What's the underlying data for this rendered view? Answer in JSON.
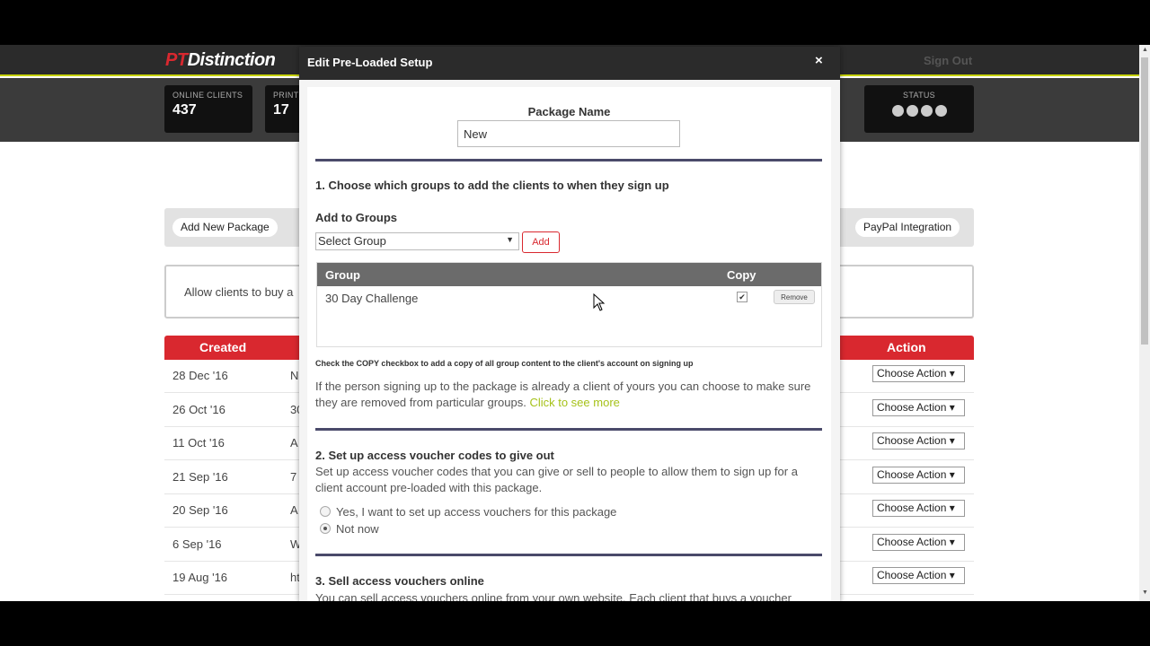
{
  "app": {
    "logo_pt": "PT",
    "logo_rest": "Distinction",
    "sign_out": "Sign Out"
  },
  "stats": {
    "online_label": "ONLINE CLIENTS",
    "online_value": "437",
    "print_label": "PRINT",
    "print_value": "17",
    "status_label": "STATUS"
  },
  "actions": {
    "add_new_package": "Add New Package",
    "paypal_integration": "PayPal Integration"
  },
  "info": {
    "text": "Allow clients to buy a"
  },
  "table": {
    "created_header": "Created",
    "action_header": "Action",
    "rows": [
      {
        "date": "28 Dec '16",
        "name": "N",
        "action": "Choose Action ▾"
      },
      {
        "date": "26 Oct '16",
        "name": "30",
        "action": "Choose Action ▾"
      },
      {
        "date": "11 Oct '16",
        "name": "A",
        "action": "Choose Action ▾"
      },
      {
        "date": "21 Sep '16",
        "name": "7",
        "action": "Choose Action ▾"
      },
      {
        "date": "20 Sep '16",
        "name": "A",
        "action": "Choose Action ▾"
      },
      {
        "date": "6 Sep '16",
        "name": "W",
        "action": "Choose Action ▾"
      },
      {
        "date": "19 Aug '16",
        "name": "ht",
        "action": "Choose Action ▾"
      }
    ]
  },
  "modal": {
    "title": "Edit Pre-Loaded Setup",
    "close": "×",
    "package_name_label": "Package Name",
    "package_name_value": "New",
    "section1_title": "1. Choose which groups to add the clients to when they sign up",
    "add_to_groups_label": "Add to Groups",
    "select_group": "Select Group",
    "add_button": "Add",
    "group_header": "Group",
    "copy_header": "Copy",
    "group_row": "30 Day Challenge",
    "remove_button": "Remove",
    "copy_note": "Check the COPY checkbox to add a copy of all group content to the client's account on signing up",
    "existing_client_text": "If the person signing up to the package is already a client of yours you can choose to make sure they are removed from particular groups.",
    "click_to_see_more": "Click to see more",
    "section2_title": "2. Set up access voucher codes to give out",
    "section2_text": "Set up access voucher codes that you can give or sell to people to allow them to sign up for a client account pre-loaded with this package.",
    "radio_yes": "Yes, I want to set up access vouchers for this package",
    "radio_no": "Not now",
    "section3_title": "3. Sell access vouchers online",
    "section3_text": "You can sell access vouchers online from your own website. Each client that buys a voucher"
  }
}
